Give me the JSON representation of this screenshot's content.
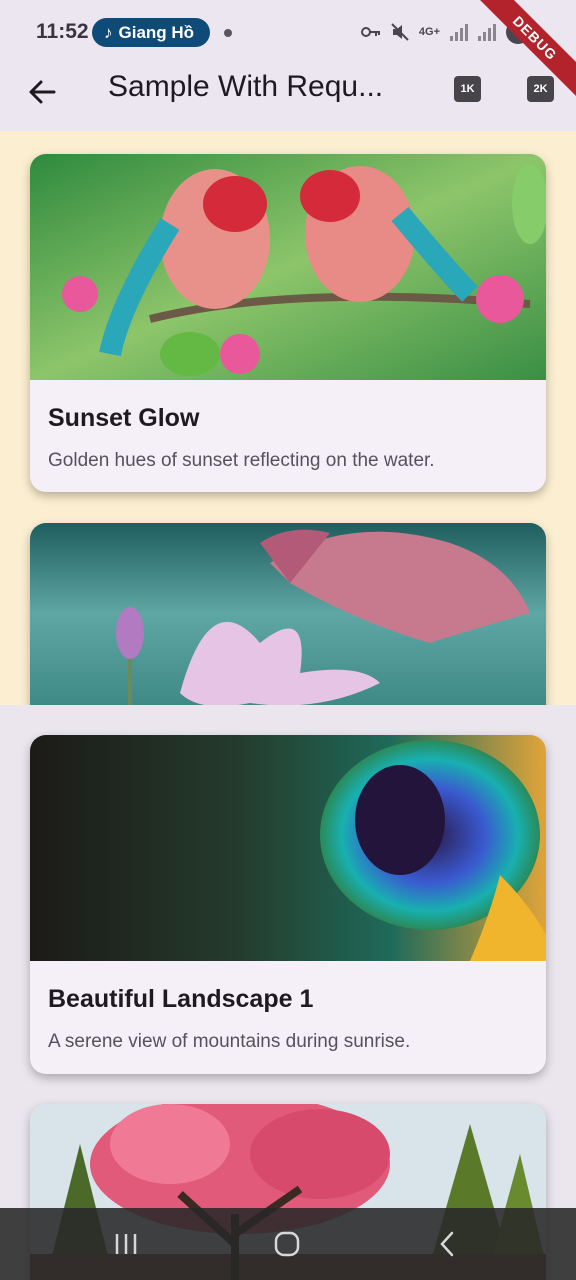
{
  "status_bar": {
    "time": "11:52",
    "notification_label": "Giang Hồ",
    "network_label": "4G+",
    "battery_level": "2"
  },
  "debug_banner": "DEBUG",
  "app_bar": {
    "title": "Sample With Requ...",
    "button_1k": "1K",
    "button_2k": "2K"
  },
  "cards": [
    {
      "title": "Sunset Glow",
      "description": "Golden hues of sunset reflecting on the water.",
      "image": "two-red-headed-birds-on-branch"
    },
    {
      "title": "",
      "description": "",
      "image": "pink-butterfly-and-lotus-over-water"
    },
    {
      "title": "Beautiful Landscape 1",
      "description": "A serene view of mountains during sunrise.",
      "image": "peacock-feather-closeup"
    },
    {
      "title": "",
      "description": "",
      "image": "pink-blossom-tree-in-forest"
    }
  ],
  "colors": {
    "top_section_bg": "#fcefd1",
    "bottom_section_bg": "#ebe6ee",
    "app_bar_bg": "#ece6f1",
    "card_bg": "#f5eff7"
  }
}
